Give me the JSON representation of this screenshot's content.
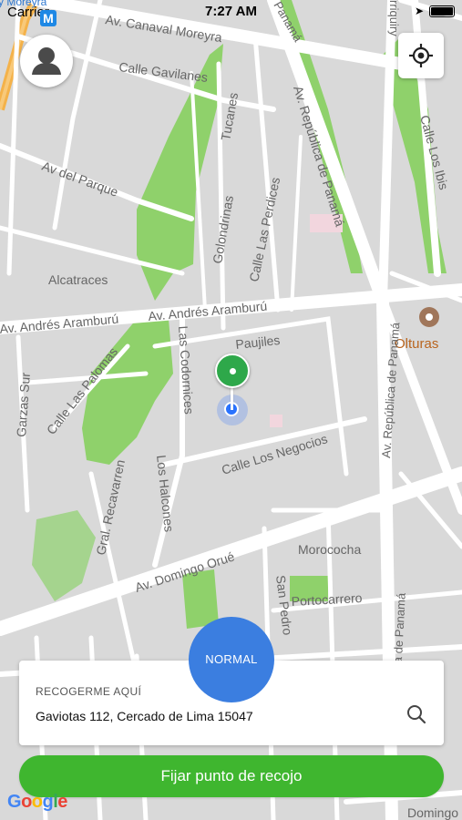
{
  "status_bar": {
    "carrier": "Carrier",
    "time": "7:27 AM",
    "location_arrow": "location-arrow-icon",
    "battery": "battery-icon"
  },
  "map": {
    "metro_badge": "M",
    "street_labels": {
      "canaval": "Av. Canaval Moreyra",
      "gavilanes": "Calle Gavilanes",
      "tucanes": "Tucanes",
      "del_parque": "Av del Parque",
      "golondrinas": "Golondrinas",
      "las_perdices": "Calle Las Perdices",
      "alcatraces": "Alcatraces",
      "aramburu_left": "Av. Andrés Aramburú",
      "aramburu_right": "Av. Andrés Aramburú",
      "republica_top": "Av. República de Panamá",
      "los_ibis": "Calle Los Ibis",
      "olturas": "Olturas",
      "las_codornices": "Las Codornices",
      "paujiles": "Paujiles",
      "las_palomas": "Calle Las Palomas",
      "garzas_sur": "Garzas Sur",
      "los_negocios": "Calle Los Negocios",
      "republica_mid": "Av. República de Panamá",
      "recavarren": "Gral. Recavarren",
      "los_halcones": "Los Halcones",
      "domingo_orue": "Av. Domingo Orué",
      "morococha": "Morococha",
      "san_pedro": "San Pedro",
      "portocarrero": "Portocarrero",
      "republica_bottom": "Av. República de Panamá",
      "panama_top": "Panamá",
      "domingo_br": "Domingo",
      "moreyra_tl": "y Moreyra",
      "marquez_tr": "rriquiry"
    },
    "attribution": "Google"
  },
  "pickup_card": {
    "label": "RECOGERME AQUÍ",
    "address": "Gaviotas 112, Cercado de Lima 15047",
    "search_icon": "search-icon"
  },
  "mode_button": {
    "label": "NORMAL"
  },
  "confirm_button": {
    "label": "Fijar punto de recojo"
  },
  "colors": {
    "map_bg": "#d9d9d9",
    "road": "#ffffff",
    "park": "#8fd16b",
    "mode_button": "#3b7ee0",
    "confirm_button": "#3fb62f",
    "pin": "#2ea84a",
    "user_dot": "#2a73ff"
  }
}
